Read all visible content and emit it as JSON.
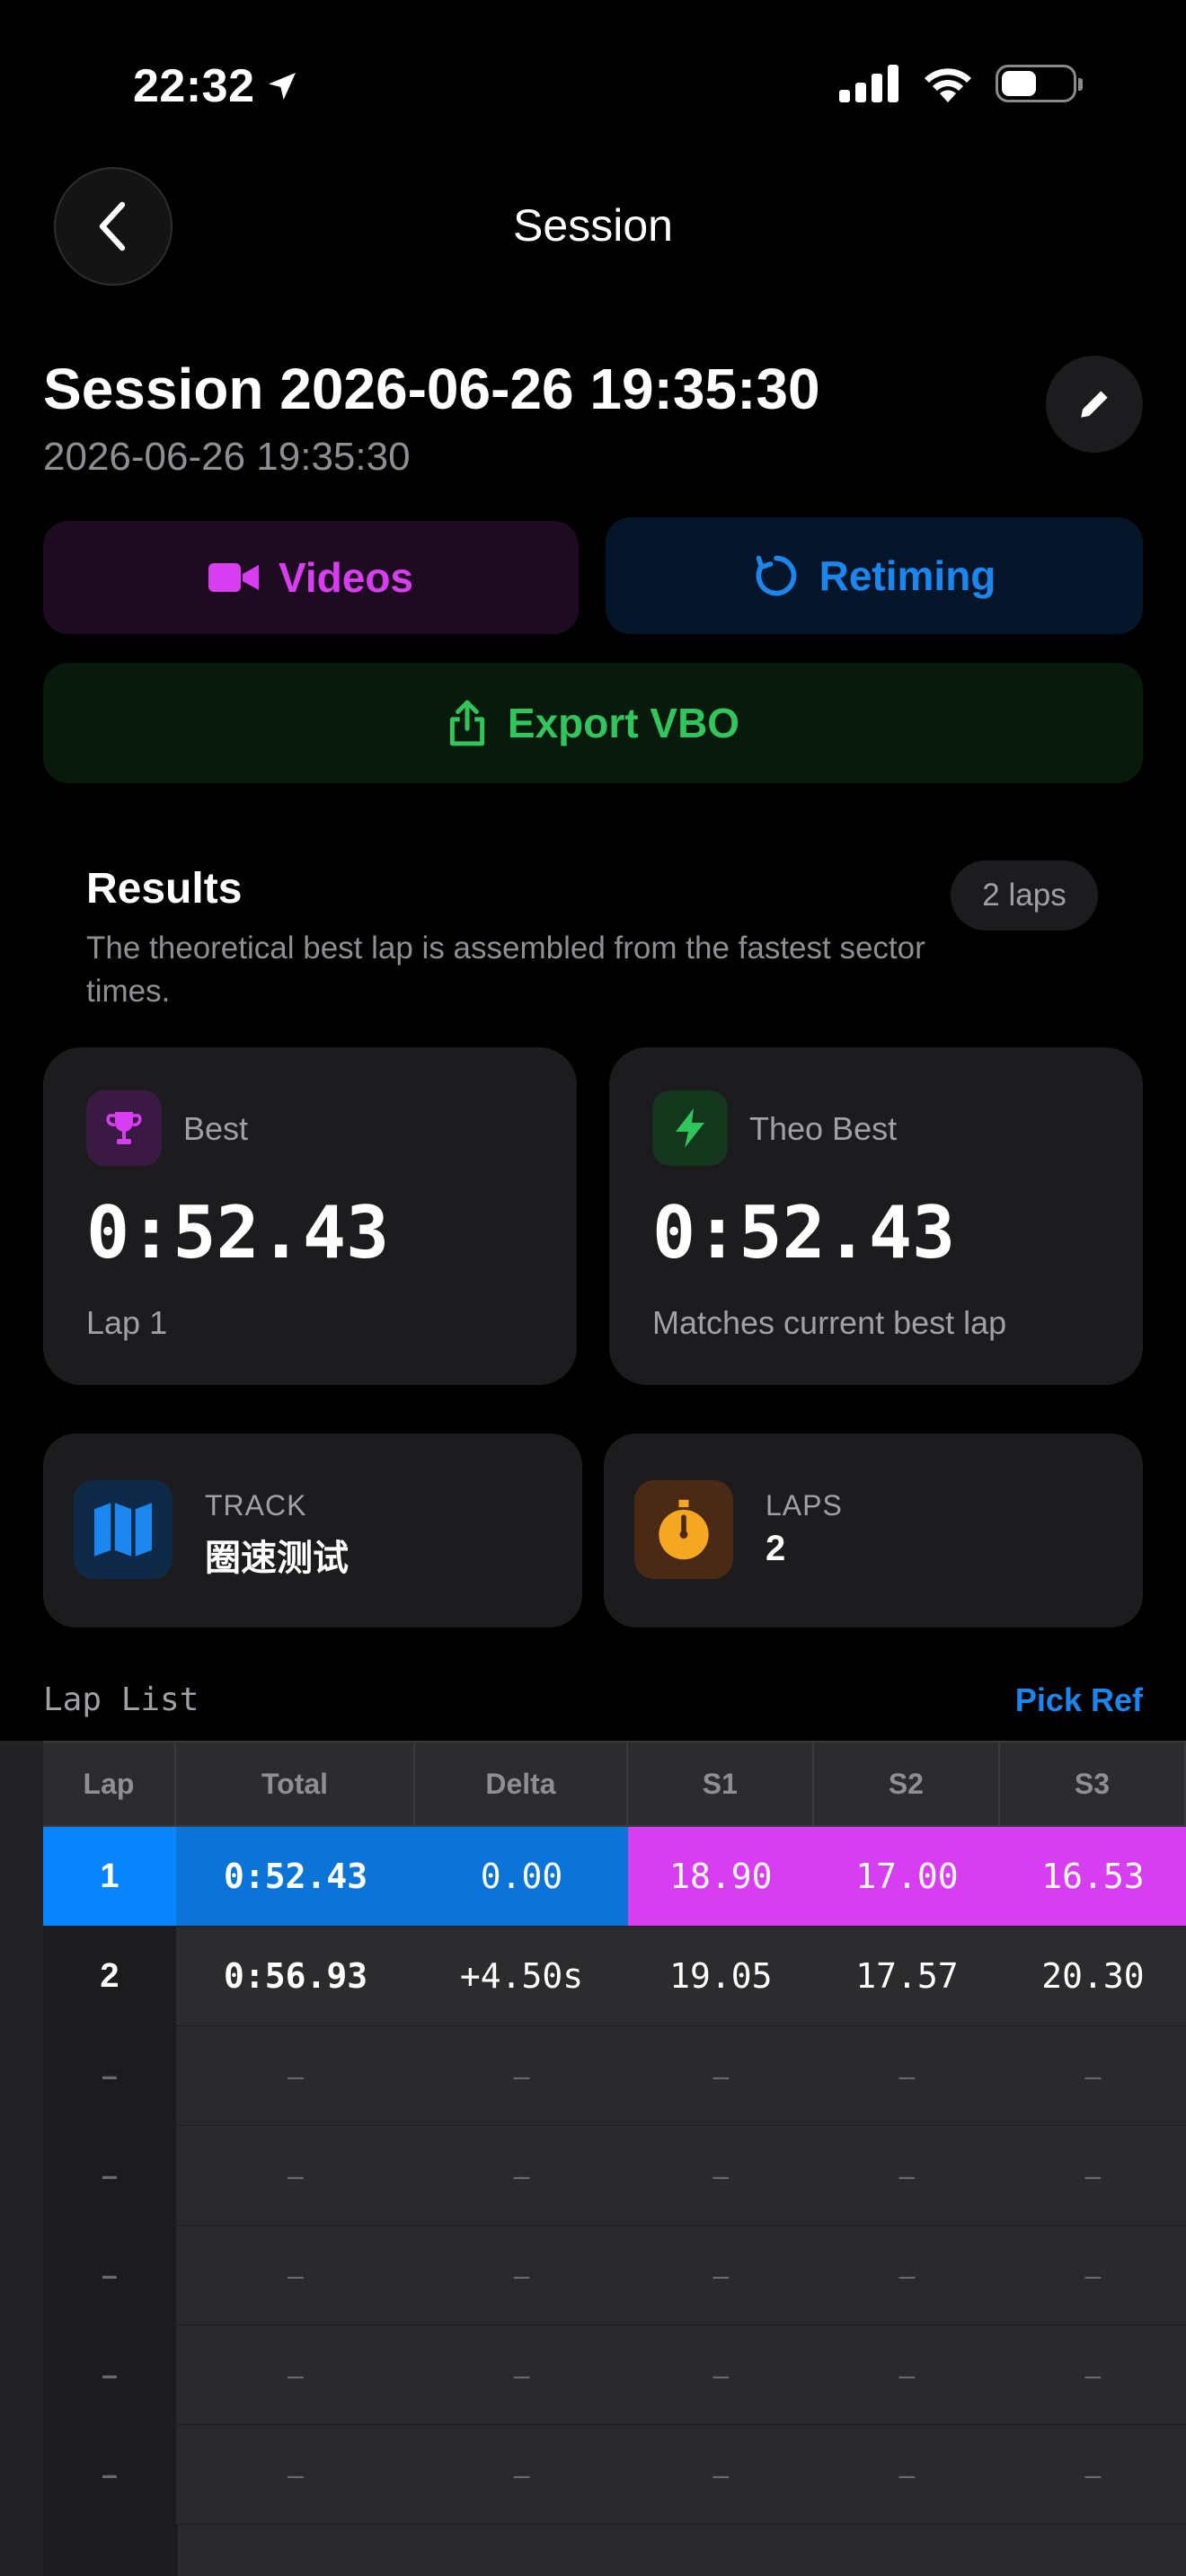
{
  "status": {
    "time": "22:32"
  },
  "nav": {
    "title": "Session"
  },
  "session": {
    "title": "Session 2026-06-26 19:35:30",
    "subtitle": "2026-06-26 19:35:30"
  },
  "actions": {
    "videos": "Videos",
    "retiming": "Retiming",
    "export": "Export VBO"
  },
  "results": {
    "title": "Results",
    "description": "The theoretical best lap is assembled from the fastest sector times.",
    "badge": "2 laps",
    "best": {
      "label": "Best",
      "value": "0:52.43",
      "foot": "Lap 1"
    },
    "theo": {
      "label": "Theo Best",
      "value": "0:52.43",
      "foot": "Matches current best lap"
    },
    "track": {
      "label": "TRACK",
      "value": "圈速测试"
    },
    "laps": {
      "label": "LAPS",
      "value": "2"
    }
  },
  "lap_list": {
    "title": "Lap List",
    "pick_ref": "Pick Ref",
    "headers": [
      "Lap",
      "Total",
      "Delta",
      "S1",
      "S2",
      "S3"
    ],
    "rows": [
      [
        "1",
        "0:52.43",
        "0.00",
        "18.90",
        "17.00",
        "16.53"
      ],
      [
        "2",
        "0:56.93",
        "+4.50s",
        "19.05",
        "17.57",
        "20.30"
      ],
      [
        "–",
        "–",
        "–",
        "–",
        "–",
        "–"
      ],
      [
        "–",
        "–",
        "–",
        "–",
        "–",
        "–"
      ],
      [
        "–",
        "–",
        "–",
        "–",
        "–",
        "–"
      ],
      [
        "–",
        "–",
        "–",
        "–",
        "–",
        "–"
      ],
      [
        "–",
        "–",
        "–",
        "–",
        "–",
        "–"
      ]
    ]
  },
  "colors": {
    "accent_blue": "#0a84ff",
    "accent_magenta": "#d63ef0",
    "accent_green": "#31c55e",
    "accent_orange": "#f5a623"
  }
}
